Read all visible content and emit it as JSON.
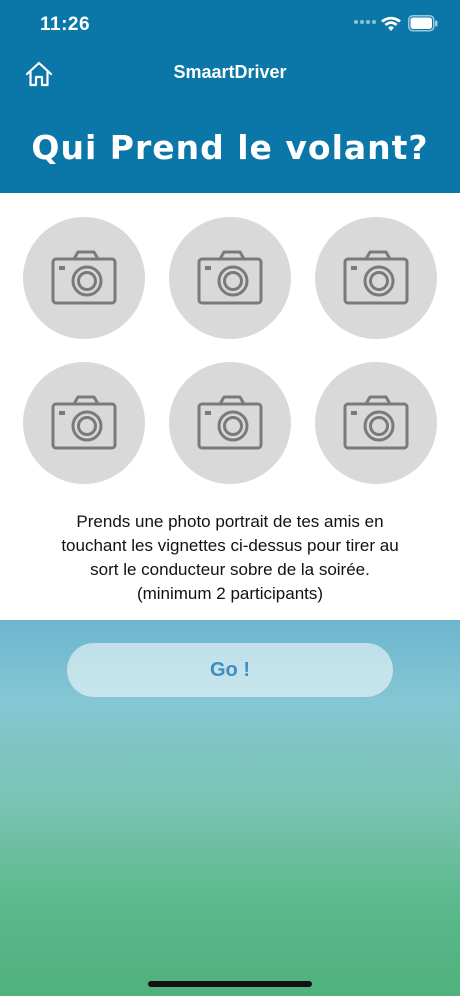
{
  "status_bar": {
    "time": "11:26"
  },
  "nav": {
    "title": "SmaartDriver"
  },
  "screen": {
    "title": "Qui Prend le volant?"
  },
  "photo_slots": [
    {
      "icon": "camera-icon"
    },
    {
      "icon": "camera-icon"
    },
    {
      "icon": "camera-icon"
    },
    {
      "icon": "camera-icon"
    },
    {
      "icon": "camera-icon"
    },
    {
      "icon": "camera-icon"
    }
  ],
  "instructions": {
    "line1": "Prends une photo portrait de tes amis en",
    "line2": "touchant les vignettes ci-dessus pour tirer au",
    "line3": "sort le conducteur sobre de la soirée.",
    "line4": "(minimum 2 participants)"
  },
  "go_button": {
    "label": "Go !"
  },
  "colors": {
    "header": "#0a77a8",
    "slot_bg": "#d9d9d9",
    "icon": "#7a7a7a",
    "go_text": "#3b8fc2"
  }
}
